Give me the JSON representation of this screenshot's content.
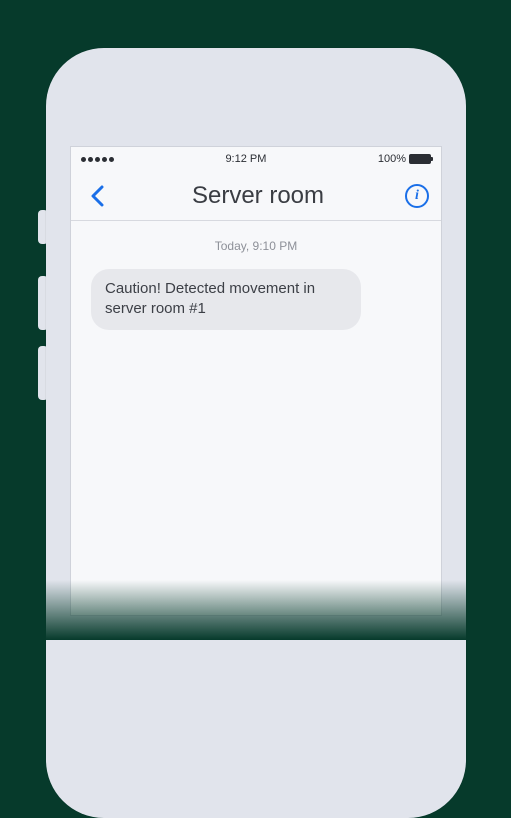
{
  "status_bar": {
    "time": "9:12 PM",
    "battery_pct": "100%"
  },
  "nav": {
    "title": "Server room",
    "info_glyph": "i"
  },
  "conversation": {
    "timestamp": "Today, 9:10 PM",
    "messages": [
      {
        "text": "Caution! Detected movement in server room #1"
      }
    ]
  }
}
